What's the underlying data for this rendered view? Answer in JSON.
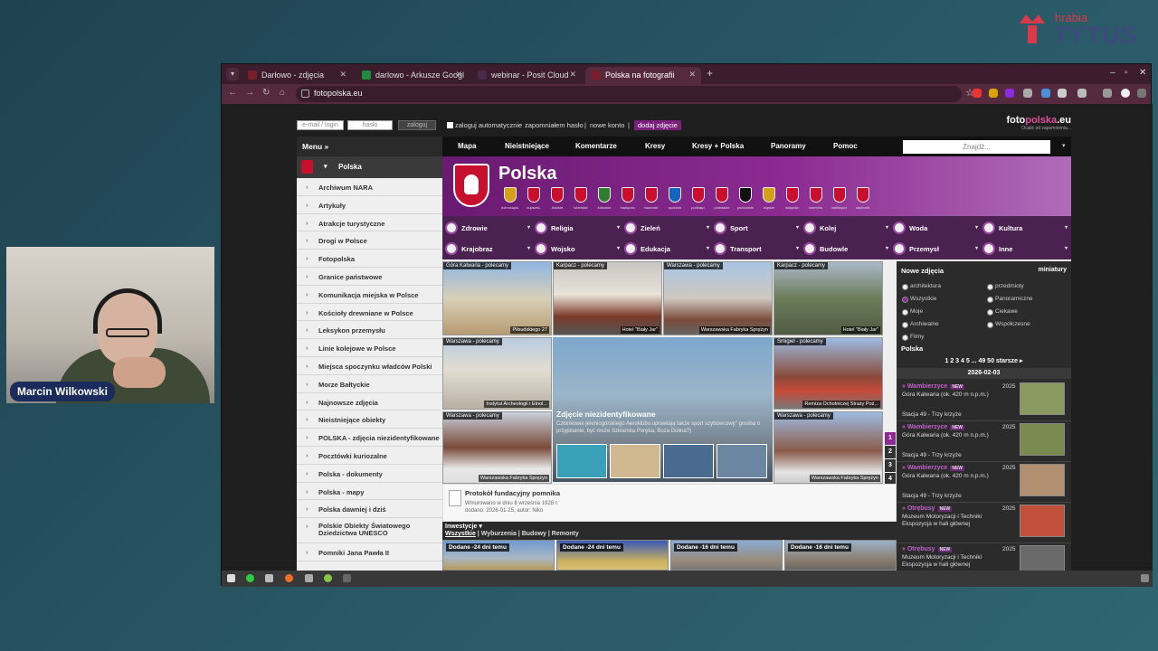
{
  "brand": {
    "line1": "hrabia",
    "line2": "TYTUS"
  },
  "participant": {
    "name": "Marcin Wilkowski"
  },
  "browser": {
    "tabs": [
      {
        "label": "Darłowo - zdjęcia",
        "active": false
      },
      {
        "label": "darlowo - Arkusze Googl",
        "active": false
      },
      {
        "label": "webinar - Posit Cloud",
        "active": false
      },
      {
        "label": "Polska na fotografii",
        "active": true
      }
    ],
    "url": "fotopolska.eu"
  },
  "site": {
    "login": {
      "email_ph": "e-mail / login",
      "pass_ph": "hasło",
      "login_btn": "zaloguj",
      "auto": "zaloguj automatycznie",
      "forgot": "zapomniałem hasło",
      "newacc": "nowe konto",
      "addphoto": "dodaj zdjęcie"
    },
    "logo": {
      "a": "foto",
      "b": "polska",
      "c": ".eu",
      "tag": "Ocalić od zapomnienia..."
    },
    "menu_label": "Menu »",
    "topmenu": [
      "Mapa",
      "Nieistniejące",
      "Komentarze",
      "Kresy",
      "Kresy + Polska",
      "Panoramy",
      "Pomoc"
    ],
    "search_ph": "Znajdź...",
    "sidebar": {
      "head": "Polska",
      "items": [
        "Archiwum NARA",
        "Artykuły",
        "Atrakcje turystyczne",
        "Drogi w Polsce",
        "Fotopolska",
        "Granice państwowe",
        "Komunikacja miejska w Polsce",
        "Kościoły drewniane w Polsce",
        "Leksykon przemysłu",
        "Linie kolejowe w Polsce",
        "Miejsca spoczynku władców Polski",
        "Morze Bałtyckie",
        "Najnowsze zdjęcia",
        "Nieistniejące obiekty",
        "POLSKA - zdjęcia niezidentyfikowane",
        "Pocztówki kuriozalne",
        "Polska - dokumenty",
        "Polska - mapy",
        "Polska dawniej i dziś",
        "Polskie Obiekty Światowego Dziedzictwa UNESCO",
        "Pomniki Jana Pawła II"
      ]
    },
    "banner": {
      "title": "Polska",
      "regions": [
        "dolnośląsk.",
        "kujawsk.",
        "łódzkie",
        "lubelskie",
        "lubuskie",
        "małopols.",
        "mazowie.",
        "opolskie",
        "podkarp.",
        "podlaskie",
        "pomorskie",
        "śląskie",
        "świętokr.",
        "warmińs.",
        "wielkopol.",
        "zachodn."
      ]
    },
    "categories": [
      "Zdrowie",
      "Religia",
      "Zieleń",
      "Sport",
      "Kolej",
      "Woda",
      "Kultura",
      "Krajobraz",
      "Wojsko",
      "Edukacja",
      "Transport",
      "Budowle",
      "Przemysł",
      "Inne"
    ],
    "photos": [
      {
        "top": "Góra Kalwaria - polecamy",
        "bottom": "Piłsudskiego 27"
      },
      {
        "top": "Karpacz - polecamy",
        "bottom": "Hotel \"Biały Jar\""
      },
      {
        "top": "Warszawa - polecamy",
        "bottom": "Warszawska Fabryka Sprężyn"
      },
      {
        "top": "Karpacz - polecamy",
        "bottom": "Hotel \"Biały Jar\""
      },
      {
        "top": "Warszawa - polecamy",
        "bottom": "Instytut Archeologii i Etnol..."
      },
      {
        "top": "Śmigiel - polecamy",
        "bottom": "Remiza Ochotniczej Straży Poż..."
      },
      {
        "top": "Warszawa - polecamy",
        "bottom": "Warszawska Fabryka Sprężyn"
      },
      {
        "top": "Warszawa - polecamy",
        "bottom": "Warszawska Fabryka Sprężyn"
      }
    ],
    "feature": {
      "title": "Zdjęcie niezidentyfikowane",
      "desc": "Członkowie jeleniogórskiego Aeroklubu uprawiają także sport szybowcowy\" grosba o przypisanie, być może Szklarska Poręba, Boża Dolina?)"
    },
    "pager": [
      "1",
      "2",
      "3",
      "4"
    ],
    "proto": {
      "title": "Protokół fundacyjny pomnika",
      "d1": "Wmurowano w dniu 8 września 1928 r.",
      "d2": "dodano: 2026-01-25, autor: Niko"
    },
    "invest": {
      "head": "Inwestycje ▾",
      "f1": "Wszystkie",
      "rest": " | Wyburzenia | Budowy | Remonty"
    },
    "dodane": [
      "Dodane -24 dni temu",
      "Dodane -24 dni temu",
      "Dodane -16 dni temu",
      "Dodane -16 dni temu"
    ],
    "right": {
      "head": "Nowe zdjęcia",
      "mini": "miniatury",
      "radios": [
        "architektura",
        "przedmioty",
        "Wszystkie",
        "Panoramiczne",
        "Moje",
        "Ciekawe",
        "Archiwalne",
        "Współczesne",
        "Filmy"
      ],
      "place": "Polska",
      "pages": "1 2 3 4 5 ... 49 50 starsze ▸",
      "date": "2026-02-03",
      "entries": [
        {
          "name": "» Wambierzyce",
          "badge": "NEW",
          "year": "2025",
          "l1": "Góra Kalwaria (ok. 420 m n.p.m.)",
          "l2": "Stacja 49 - Trzy krzyże"
        },
        {
          "name": "» Wambierzyce",
          "badge": "NEW",
          "year": "2025",
          "l1": "Góra Kalwaria (ok. 420 m n.p.m.)",
          "l2": "Stacja 49 - Trzy krzyże"
        },
        {
          "name": "» Wambierzyce",
          "badge": "NEW",
          "year": "2025",
          "l1": "Góra Kalwaria (ok. 420 m n.p.m.)",
          "l2": "Stacja 49 - Trzy krzyże"
        },
        {
          "name": "» Otrębusy",
          "badge": "NEW",
          "year": "2025",
          "l1": "Muzeum Motoryzacji i Techniki",
          "l2": "Ekspozycja w hali głównej"
        },
        {
          "name": "» Otrębusy",
          "badge": "NEW",
          "year": "2025",
          "l1": "Muzeum Motoryzacji i Techniki",
          "l2": "Ekspozycja w hali głównej"
        }
      ]
    }
  }
}
